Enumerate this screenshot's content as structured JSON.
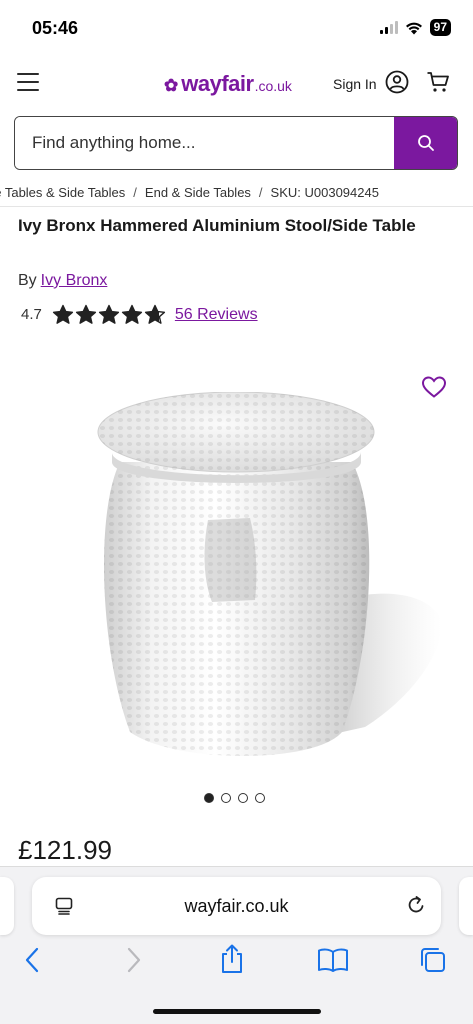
{
  "status_bar": {
    "time": "05:46",
    "battery": "97"
  },
  "header": {
    "logo_name": "wayfair",
    "logo_tld": ".co.uk",
    "signin_label": "Sign In"
  },
  "search": {
    "placeholder": "Find anything home..."
  },
  "breadcrumb": {
    "items": [
      "ee Tables & Side Tables",
      "End & Side Tables"
    ],
    "sku": "SKU: U003094245",
    "separator": "/"
  },
  "product": {
    "title": "Ivy Bronx Hammered Aluminium Stool/Side Table",
    "by_label": "By",
    "brand": "Ivy Bronx",
    "rating": "4.7",
    "rating_stars": 4.7,
    "reviews_label": "56 Reviews",
    "price": "£121.99",
    "image_count": 4,
    "image_index": 1
  },
  "browser": {
    "url": "wayfair.co.uk"
  },
  "colors": {
    "brand": "#7b189f",
    "ios_blue": "#1a73e8"
  }
}
